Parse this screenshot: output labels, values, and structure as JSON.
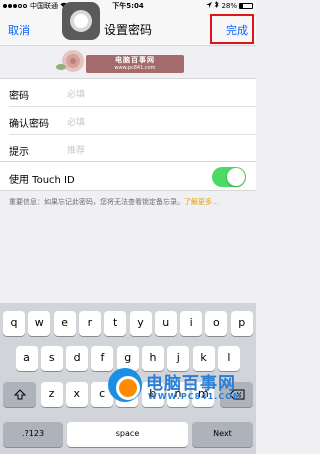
{
  "status_bar": {
    "carrier": "中国联通",
    "wifi": "wifi",
    "time": "下午5:04",
    "battery_text": "28%",
    "battery_level": 0.28,
    "icons": [
      "location-icon",
      "bluetooth-icon"
    ]
  },
  "nav": {
    "cancel": "取消",
    "title": "设置密码",
    "done": "完成",
    "accent": "#0a60ff",
    "highlight": "#e0151b"
  },
  "watermark_top": {
    "title": "电脑百事网",
    "url": "www.pc841.com"
  },
  "form": {
    "rows": [
      {
        "label": "密码",
        "placeholder": "必填"
      },
      {
        "label": "确认密码",
        "placeholder": "必填"
      },
      {
        "label": "提示",
        "placeholder": "推荐"
      }
    ]
  },
  "touch_id": {
    "label": "使用 Touch ID",
    "enabled": true,
    "color": "#4cd964"
  },
  "note": {
    "text": "重要信息：如果忘记此密码，您将无法查看锁定备忘录。",
    "link": "了解更多..."
  },
  "keyboard": {
    "row1": [
      "q",
      "w",
      "e",
      "r",
      "t",
      "y",
      "u",
      "i",
      "o",
      "p"
    ],
    "row2": [
      "a",
      "s",
      "d",
      "f",
      "g",
      "h",
      "j",
      "k",
      "l"
    ],
    "row3": [
      "z",
      "x",
      "c",
      "v",
      "b",
      "n",
      "m"
    ],
    "shift_icon": "shift-icon",
    "delete_icon": "delete-icon",
    "numbers": ".?123",
    "space": "space",
    "next": "Next"
  },
  "watermark_bottom": {
    "title": "电脑百事网",
    "url": "WWW.PC841.COM"
  }
}
